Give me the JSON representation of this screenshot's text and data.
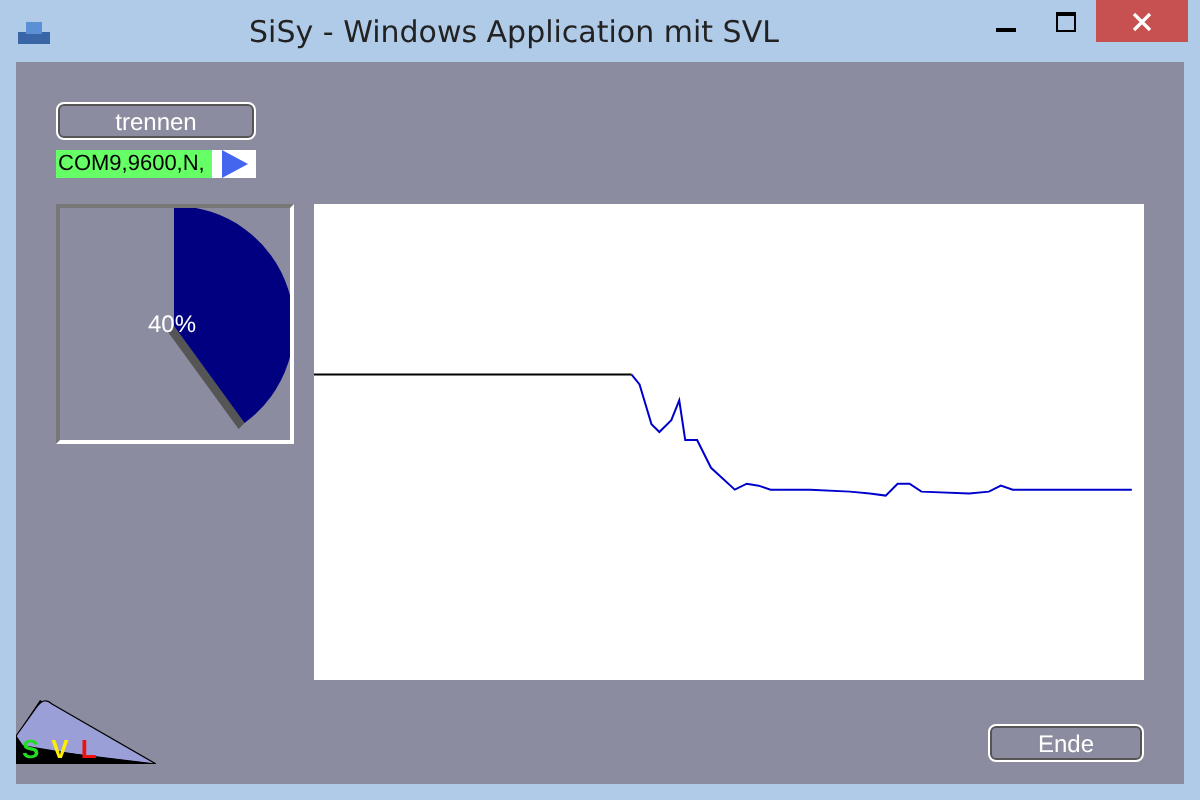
{
  "window": {
    "title": "SiSy - Windows Application mit SVL"
  },
  "connect_button": {
    "label": "trennen"
  },
  "port_field": {
    "value": "COM9,9600,N,"
  },
  "pie": {
    "label": "40%"
  },
  "logo": {
    "letters": [
      "S",
      "V",
      "L"
    ]
  },
  "exit_button": {
    "label": "Ende"
  }
}
